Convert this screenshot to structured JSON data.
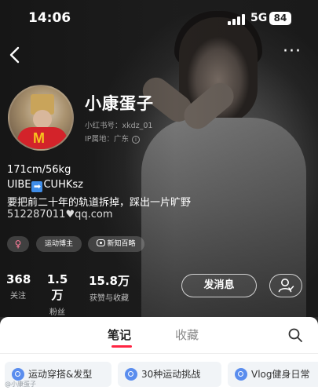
{
  "status_bar": {
    "time": "14:06",
    "network": "5G",
    "battery": "84"
  },
  "topbar": {
    "back_icon": "chevron-left-icon",
    "more_label": "···"
  },
  "profile": {
    "name": "小康蛋子",
    "red_id": "小红书号：xkdz_01",
    "ip_location": "IP属地：广东",
    "avatar_text": "M",
    "bio": {
      "line1": "171cm/56kg",
      "line2_pre": "UIBE",
      "line2_arrow": "➡",
      "line2_post": "CUHKsz",
      "line3": "要把前二十年的轨道拆掉，踩出一片旷野",
      "line4": "512287011♥qq.com"
    },
    "tags": {
      "gender": "♀",
      "sport": "运动博主",
      "news": "新知百略"
    }
  },
  "stats": [
    {
      "value": "368",
      "label": "关注"
    },
    {
      "value": "1.5万",
      "label": "粉丝"
    },
    {
      "value": "15.8万",
      "label": "获赞与收藏"
    }
  ],
  "actions": {
    "message": "发消息"
  },
  "tabs": {
    "notes": "笔记",
    "favorites": "收藏"
  },
  "collections": [
    {
      "label": "运动穿搭&发型"
    },
    {
      "label": "30种运动挑战"
    },
    {
      "label": "Vlog健身日常"
    }
  ],
  "watermark": "@小康蛋子",
  "colors": {
    "accent": "#ff2442",
    "chip_icon": "#5a8dee",
    "arrow_box": "#3f8de8"
  }
}
